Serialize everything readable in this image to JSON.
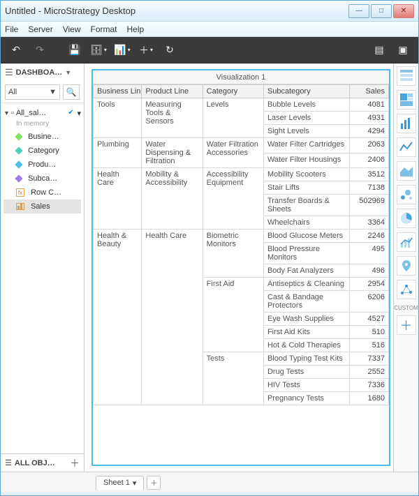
{
  "window": {
    "title": "Untitled - MicroStrategy Desktop"
  },
  "menu": {
    "file": "File",
    "server": "Server",
    "view": "View",
    "format": "Format",
    "help": "Help"
  },
  "sidebar": {
    "panel_label": "DASHBOA…",
    "filter_all": "All",
    "root": "All_sal…",
    "in_memory": "In memory",
    "items": [
      {
        "label": "Busine…"
      },
      {
        "label": "Category"
      },
      {
        "label": "Produ…"
      },
      {
        "label": "Subca…"
      }
    ],
    "rowc": "Row C…",
    "sales": "Sales",
    "allobj": "ALL OBJ…"
  },
  "viz": {
    "title": "Visualization 1",
    "columns": [
      "Business Line",
      "Product Line",
      "Category",
      "Subcategory",
      "Sales"
    ]
  },
  "iconrail": {
    "custom": "CUSTOM"
  },
  "sheets": {
    "s1": "Sheet 1"
  },
  "chart_data": {
    "type": "table",
    "columns": [
      "Business Line",
      "Product Line",
      "Category",
      "Subcategory",
      "Sales"
    ],
    "rows": [
      {
        "bl": "Tools",
        "pl": "Measuring Tools & Sensors",
        "cat": "Levels",
        "subs": [
          [
            "Bubble Levels",
            4081
          ],
          [
            "Laser Levels",
            4931
          ],
          [
            "Sight Levels",
            4294
          ]
        ]
      },
      {
        "bl": "Plumbing",
        "pl": "Water Dispensing & Filtration",
        "cat": "Water Filtration Accessories",
        "subs": [
          [
            "Water Filter Cartridges",
            2063
          ],
          [
            "Water Filter Housings",
            2406
          ]
        ]
      },
      {
        "bl": "Health Care",
        "pl": "Mobility & Accessibility",
        "cat": "Accessibility Equipment",
        "subs": [
          [
            "Mobility Scooters",
            3512
          ],
          [
            "Stair Lifts",
            7138
          ],
          [
            "Transfer Boards & Sheets",
            502969
          ],
          [
            "Wheelchairs",
            3364
          ]
        ]
      },
      {
        "bl": "Health & Beauty",
        "pl": "Health Care",
        "groups": [
          {
            "cat": "Biometric Monitors",
            "subs": [
              [
                "Blood Glucose Meters",
                2246
              ],
              [
                "Blood Pressure Monitors",
                495
              ],
              [
                "Body Fat Analyzers",
                496
              ]
            ]
          },
          {
            "cat": "First Aid",
            "subs": [
              [
                "Antiseptics & Cleaning",
                2954
              ],
              [
                "Cast & Bandage Protectors",
                6206
              ],
              [
                "Eye Wash Supplies",
                4527
              ],
              [
                "First Aid Kits",
                510
              ],
              [
                "Hot & Cold Therapies",
                516
              ]
            ]
          },
          {
            "cat": "Tests",
            "subs": [
              [
                "Blood Typing Test Kits",
                7337
              ],
              [
                "Drug Tests",
                2552
              ],
              [
                "HIV Tests",
                7336
              ],
              [
                "Pregnancy Tests",
                1680
              ]
            ]
          }
        ]
      }
    ]
  }
}
